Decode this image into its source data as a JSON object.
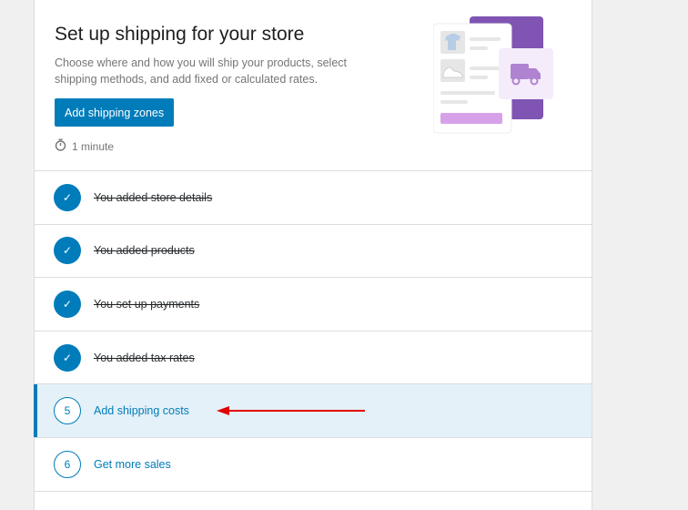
{
  "hero": {
    "title": "Set up shipping for your store",
    "description": "Choose where and how you will ship your products, select shipping methods, and add fixed or calculated rates.",
    "button_label": "Add shipping zones",
    "time_estimate": "1 minute"
  },
  "tasks": [
    {
      "label": "You added store details",
      "status": "done",
      "badge": "✓"
    },
    {
      "label": "You added products",
      "status": "done",
      "badge": "✓"
    },
    {
      "label": "You set up payments",
      "status": "done",
      "badge": "✓"
    },
    {
      "label": "You added tax rates",
      "status": "done",
      "badge": "✓"
    },
    {
      "label": "Add shipping costs",
      "status": "active",
      "badge": "5"
    },
    {
      "label": "Get more sales",
      "status": "todo",
      "badge": "6"
    }
  ],
  "colors": {
    "accent": "#007cba",
    "active_row_bg": "#e5f1f8",
    "annotation_arrow": "#e00000",
    "illustration_purple": "#7f54b3"
  },
  "icons": {
    "timer": "stopwatch-icon",
    "done": "checkmark-icon",
    "truck": "truck-icon"
  }
}
